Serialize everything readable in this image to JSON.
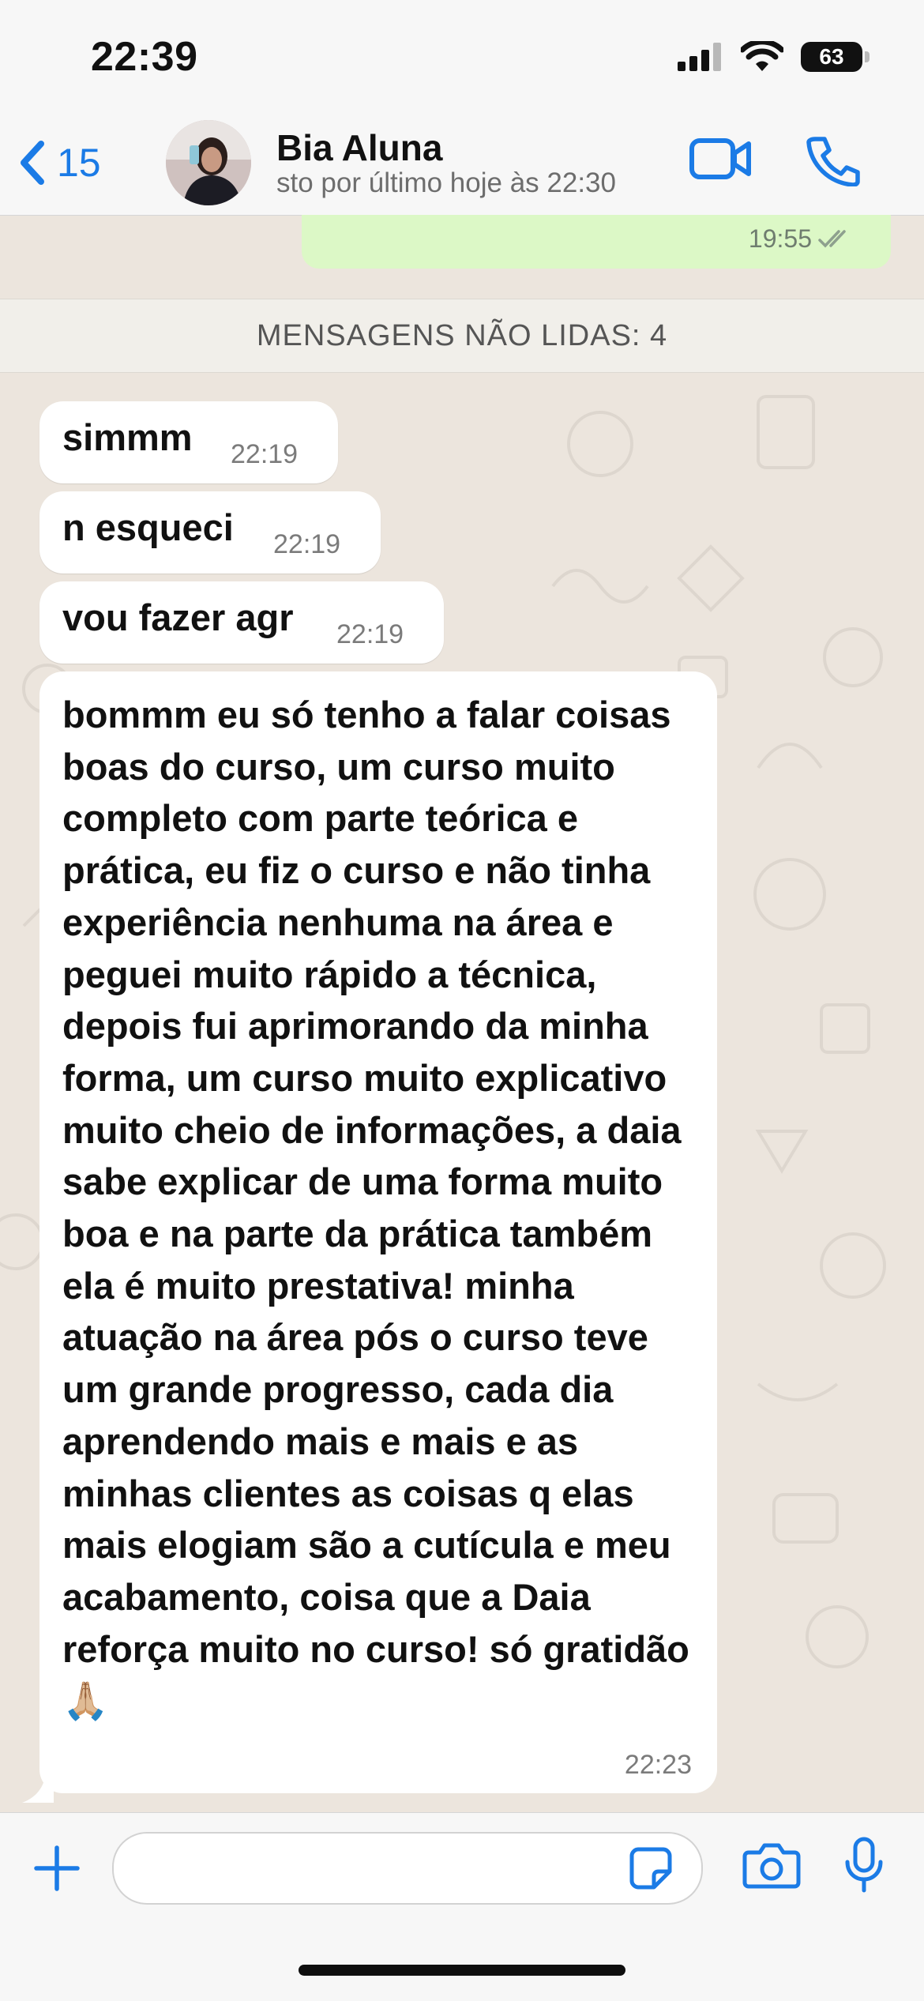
{
  "status_bar": {
    "time": "22:39",
    "battery": "63"
  },
  "header": {
    "back_count": "15",
    "contact_name": "Bia Aluna",
    "contact_status": "sto por último hoje às 22:30"
  },
  "chat": {
    "outgoing_last_time": "19:55",
    "unread_label": "MENSAGENS NÃO LIDAS: 4",
    "messages": [
      {
        "text": "simmm",
        "time": "22:19"
      },
      {
        "text": "n esqueci",
        "time": "22:19"
      },
      {
        "text": "vou fazer agr",
        "time": "22:19"
      },
      {
        "text": "bommm eu só tenho a falar coisas boas do curso, um curso muito completo com parte teórica e prática, eu fiz o curso e não tinha experiência nenhuma na área e peguei muito rápido a técnica, depois fui aprimorando da minha forma, um curso muito explicativo muito cheio de informações, a daia sabe explicar de uma forma muito boa e na parte da prática também ela é muito prestativa! minha atuação na área pós o curso teve um grande progresso, cada dia aprendendo mais e mais e as minhas clientes as coisas q elas mais elogiam são a cutícula e meu acabamento, coisa que a Daia reforça muito no curso! só gratidão🙏🏼",
        "time": "22:23"
      }
    ]
  },
  "composer": {
    "placeholder": ""
  },
  "colors": {
    "accent": "#1b7be6",
    "outgoing_bubble": "#dcf8c6",
    "incoming_bubble": "#ffffff",
    "chat_bg": "#ece5dd"
  },
  "icons": [
    "signal-icon",
    "wifi-icon",
    "battery-icon",
    "back-chevron-icon",
    "video-call-icon",
    "phone-call-icon",
    "read-receipt-icon",
    "plus-icon",
    "sticker-icon",
    "camera-icon",
    "microphone-icon"
  ]
}
